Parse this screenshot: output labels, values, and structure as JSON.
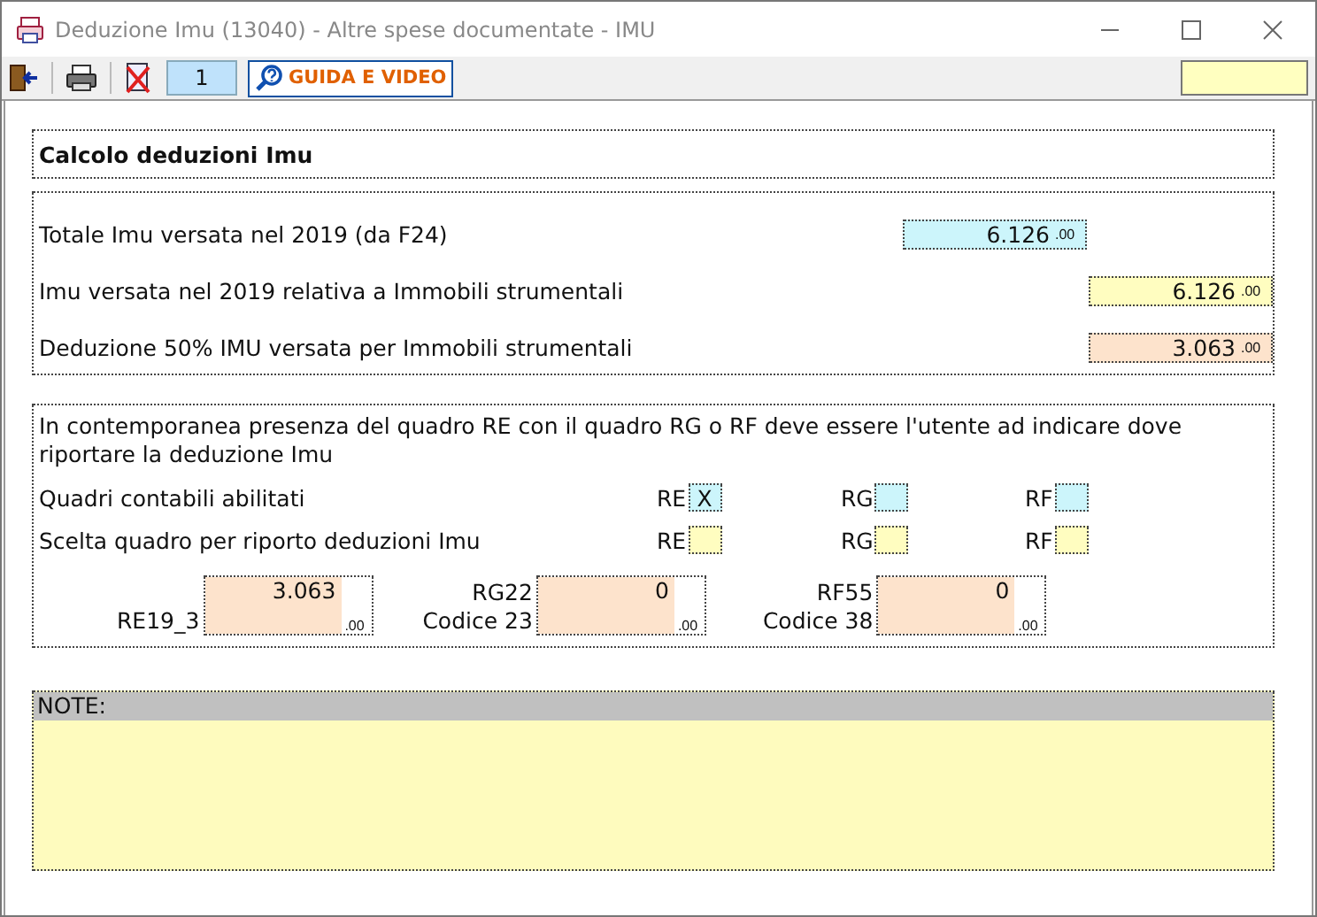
{
  "window": {
    "title": "Deduzione Imu (13040) - Altre spese documentate - IMU"
  },
  "toolbar": {
    "page_number": "1",
    "help_button": "GUIDA E VIDEO"
  },
  "section_title": "Calcolo deduzioni Imu",
  "amounts": [
    {
      "label": "Totale Imu versata nel 2019 (da F24)",
      "value": "6.126",
      "decimals": ".00",
      "kind": "computed"
    },
    {
      "label": "Imu versata nel 2019 relativa a Immobili strumentali",
      "value": "6.126",
      "decimals": ".00",
      "kind": "input"
    },
    {
      "label": "Deduzione 50% IMU versata per Immobili strumentali",
      "value": "3.063",
      "decimals": ".00",
      "kind": "result"
    }
  ],
  "notice": "In contemporanea presenza del quadro RE con il quadro RG o RF deve essere l'utente ad indicare dove riportare la deduzione Imu",
  "flag_rows": [
    {
      "label": "Quadri contabili abilitati",
      "kind": "computed",
      "flags": [
        {
          "code": "RE",
          "value": "X"
        },
        {
          "code": "RG"
        },
        {
          "code": "RF"
        }
      ]
    },
    {
      "label": "Scelta quadro per riporto deduzioni Imu",
      "kind": "input",
      "flags": [
        {
          "code": "RE"
        },
        {
          "code": "RG"
        },
        {
          "code": "RF"
        }
      ]
    }
  ],
  "transfers": [
    {
      "label_bottom": "RE19_3",
      "value": "3.063",
      "decimals": ".00"
    },
    {
      "label_top": "RG22",
      "label_bottom": "Codice 23",
      "value": "0",
      "decimals": ".00"
    },
    {
      "label_top": "RF55",
      "label_bottom": "Codice 38",
      "value": "0",
      "decimals": ".00"
    }
  ],
  "note": {
    "label": "NOTE:"
  }
}
